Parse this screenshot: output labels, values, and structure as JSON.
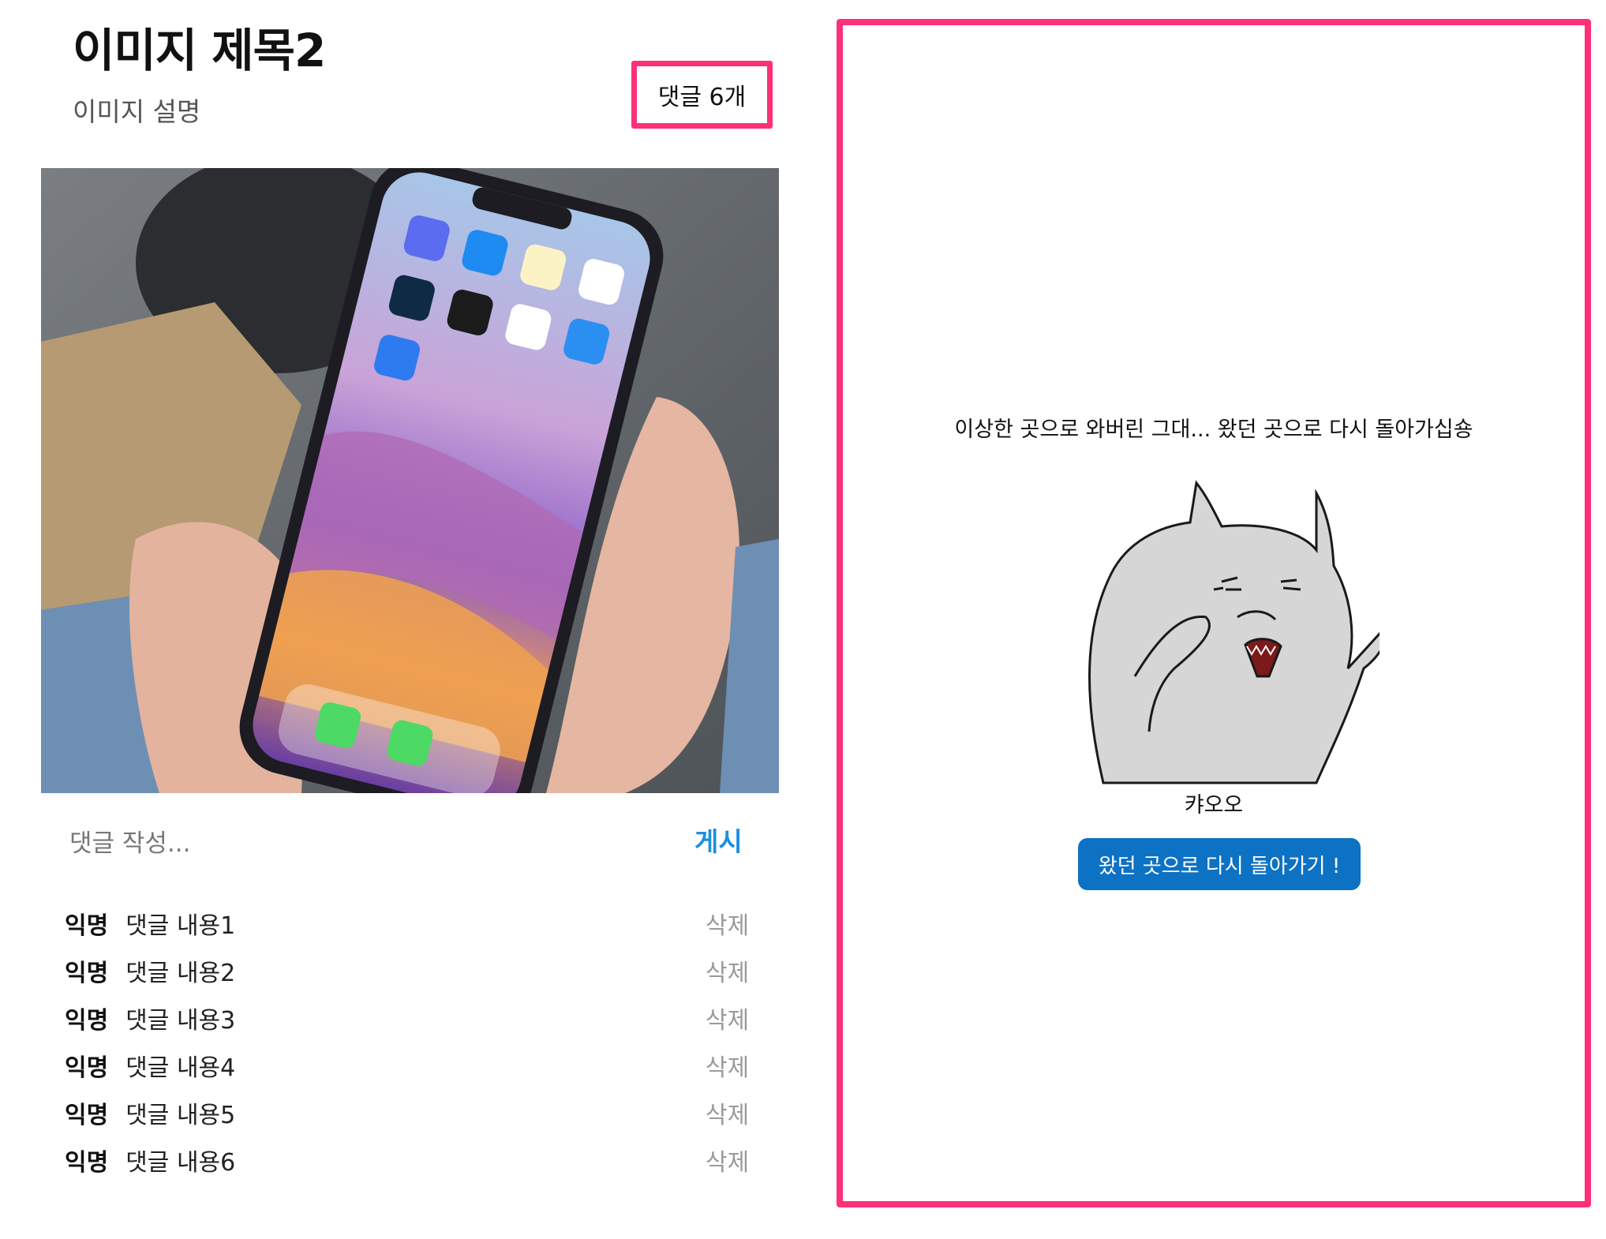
{
  "post": {
    "title": "이미지 제목2",
    "description": "이미지 설명",
    "comment_count": "댓글 6개"
  },
  "comment_form": {
    "placeholder": "댓글 작성...",
    "submit_label": "게시"
  },
  "comments": [
    {
      "author": "익명",
      "text": "댓글 내용1",
      "delete_label": "삭제"
    },
    {
      "author": "익명",
      "text": "댓글 내용2",
      "delete_label": "삭제"
    },
    {
      "author": "익명",
      "text": "댓글 내용3",
      "delete_label": "삭제"
    },
    {
      "author": "익명",
      "text": "댓글 내용4",
      "delete_label": "삭제"
    },
    {
      "author": "익명",
      "text": "댓글 내용5",
      "delete_label": "삭제"
    },
    {
      "author": "익명",
      "text": "댓글 내용6",
      "delete_label": "삭제"
    }
  ],
  "not_found": {
    "message": "이상한 곳으로 와버린 그대... 왔던 곳으로 다시 돌아가십숑",
    "caption": "캬오오",
    "button_label": "왔던 곳으로 다시 돌아가기 !"
  },
  "colors": {
    "highlight_border": "#ff2f7a",
    "post_button": "#1a8fe0",
    "back_button": "#0d72c4"
  },
  "icons": [
    "phone-photo",
    "cat-illustration"
  ]
}
